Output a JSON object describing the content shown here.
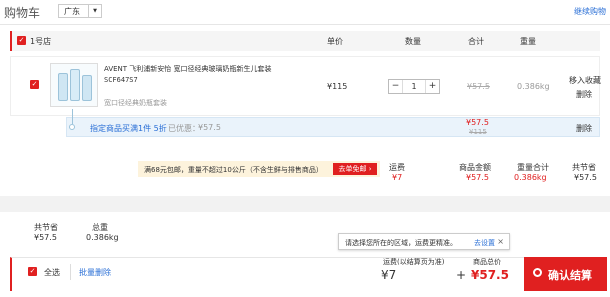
{
  "header": {
    "title": "购物车",
    "region": "广东",
    "continue_shopping": "继续购物"
  },
  "store": {
    "name": "1号店",
    "col_price": "单价",
    "col_qty": "数量",
    "col_total": "合计",
    "col_weight": "重量"
  },
  "item": {
    "brand_title": "AVENT 飞利浦新安怡 宽口径经典玻璃奶瓶新生儿套装",
    "sku": "SCF647S7",
    "variant": "宽口径经典奶瓶套装",
    "price": "¥115",
    "qty": "1",
    "total_old": "¥57.5",
    "weight": "0.386kg",
    "move_fav": "移入收藏",
    "delete": "删除"
  },
  "promo": {
    "text": "指定商品买满1件 5折",
    "discount_label": "已优惠：",
    "discount_value": "¥57.5",
    "total_new": "¥57.5",
    "total_old": "¥115",
    "delete": "删除"
  },
  "shipping": {
    "notice": "满68元包邮，重量不超过10公斤（不含生鲜与排售商品）",
    "button": "去单免邮",
    "freight_label": "运费",
    "freight_value": "¥7",
    "goods_total_label": "商品金额",
    "goods_total_value": "¥57.5",
    "weight_total_label": "重量合计",
    "weight_total_value": "0.386kg",
    "saved_label": "共节省",
    "saved_value": "¥57.5"
  },
  "summary": {
    "saved_label": "共节省",
    "saved_value": "¥57.5",
    "weight_label": "总重",
    "weight_value": "0.386kg"
  },
  "tooltip": {
    "text": "请选择您所在的区域，运费更精准。",
    "link": "去设置"
  },
  "bottom": {
    "select_all": "全选",
    "batch_delete": "批量删除",
    "freight_label": "运费(以结算页为准)",
    "freight_value": "¥7",
    "plus": "+",
    "goods_label": "商品总价",
    "goods_value": "¥57.5",
    "checkout": "确认结算"
  },
  "colors": {
    "accent": "#e02020",
    "promo_bg": "#eaf3fb",
    "notice_bg": "#fdf3dc"
  }
}
